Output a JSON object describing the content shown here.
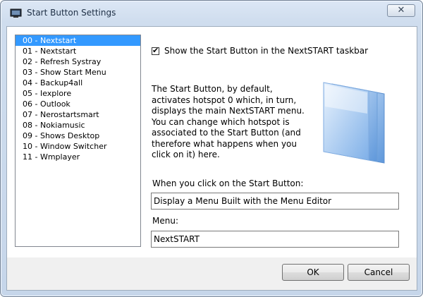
{
  "window": {
    "title": "Start Button Settings",
    "close_label": "✕"
  },
  "hotspots": [
    {
      "label": "00 - Nextstart",
      "selected": true
    },
    {
      "label": "01 - Nextstart",
      "selected": false
    },
    {
      "label": "02 - Refresh Systray",
      "selected": false
    },
    {
      "label": "03 - Show Start Menu",
      "selected": false
    },
    {
      "label": "04 - Backup4all",
      "selected": false
    },
    {
      "label": "05 - Iexplore",
      "selected": false
    },
    {
      "label": "06 - Outlook",
      "selected": false
    },
    {
      "label": "07 - Nerostartsmart",
      "selected": false
    },
    {
      "label": "08 - Nokiamusic",
      "selected": false
    },
    {
      "label": "09 - Shows Desktop",
      "selected": false
    },
    {
      "label": "10 - Window Switcher",
      "selected": false
    },
    {
      "label": "11 - Wmplayer",
      "selected": false
    }
  ],
  "settings": {
    "show_checkbox": {
      "checked": true,
      "label": "Show the Start Button in the NextSTART taskbar"
    },
    "description": "The Start Button, by default, activates hotspot 0 which, in turn, displays the main NextSTART menu. You can change which hotspot is associated to the Start Button (and therefore what happens when you click on it) here.",
    "on_click_label": "When you click on the Start Button:",
    "on_click_value": "Display a Menu Built with the Menu Editor",
    "menu_label": "Menu:",
    "menu_value": "NextSTART"
  },
  "buttons": {
    "ok": "OK",
    "cancel": "Cancel"
  },
  "colors": {
    "selection": "#3399ff",
    "title_bar": "#cfddee"
  }
}
